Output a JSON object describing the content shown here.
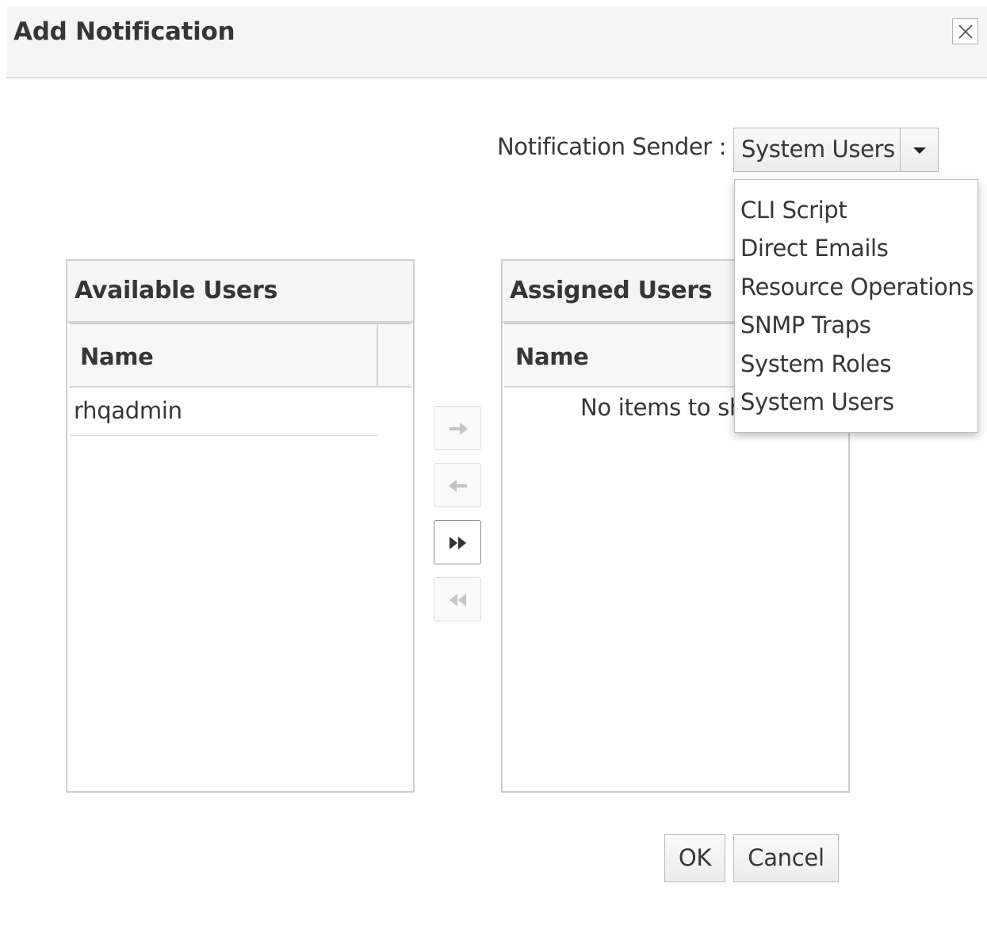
{
  "dialog": {
    "title": "Add Notification"
  },
  "sender": {
    "label": "Notification Sender :",
    "selected": "System Users",
    "options": [
      "CLI Script",
      "Direct Emails",
      "Resource Operations",
      "SNMP Traps",
      "System Roles",
      "System Users"
    ]
  },
  "available": {
    "title": "Available Users",
    "column": "Name",
    "rows": [
      "rhqadmin"
    ]
  },
  "assigned": {
    "title": "Assigned Users",
    "column": "Name",
    "empty_message": "No items to show"
  },
  "transfer_buttons": [
    {
      "icon": "arrow-right-icon",
      "enabled": false
    },
    {
      "icon": "arrow-left-icon",
      "enabled": false
    },
    {
      "icon": "double-chevron-right-icon",
      "enabled": true
    },
    {
      "icon": "double-chevron-left-icon",
      "enabled": false
    }
  ],
  "footer": {
    "ok_label": "OK",
    "cancel_label": "Cancel"
  },
  "colors": {
    "header_bg": "#f5f5f5",
    "text": "#363636",
    "border": "#cfcfcf",
    "disabled_icon": "#c4c4c4",
    "enabled_icon": "#333333"
  }
}
